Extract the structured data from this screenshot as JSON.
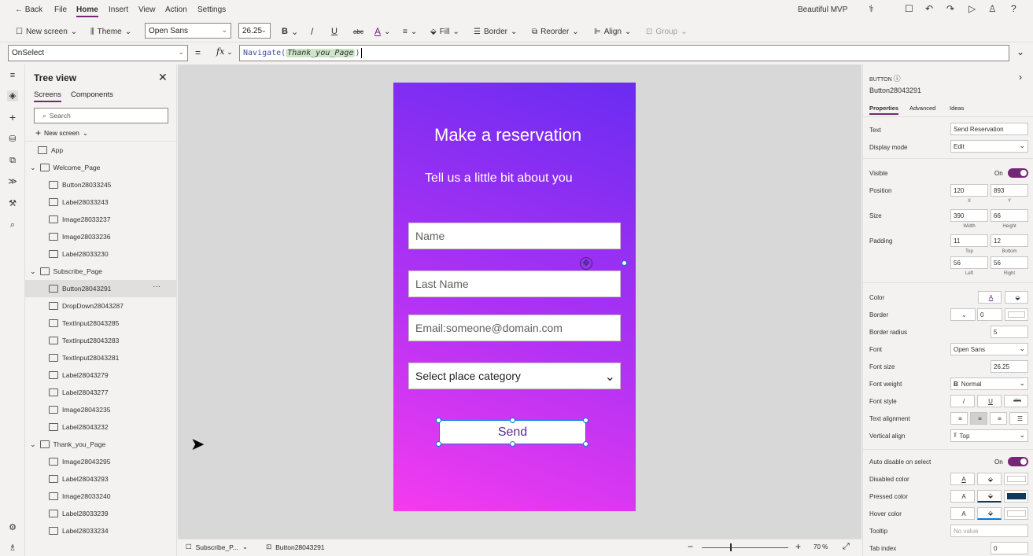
{
  "topbar": {
    "back": "Back",
    "menu": [
      "File",
      "Home",
      "Insert",
      "View",
      "Action",
      "Settings"
    ],
    "app_name": "Beautiful MVP"
  },
  "ribbon": {
    "new_screen": "New screen",
    "theme": "Theme",
    "font": "Open Sans",
    "font_size": "26.25",
    "bold": "B",
    "italic": "/",
    "underline": "U",
    "strike": "abc",
    "font_color": "A",
    "fill": "Fill",
    "border": "Border",
    "reorder": "Reorder",
    "align": "Align",
    "group": "Group"
  },
  "formula": {
    "property": "OnSelect",
    "equals": "=",
    "fx": "fx",
    "fn": "Navigate(",
    "arg": "Thank_you_Page",
    "close": ")"
  },
  "tree": {
    "title": "Tree view",
    "tabs": [
      "Screens",
      "Components"
    ],
    "search_placeholder": "Search",
    "new_screen": "New screen",
    "nodes": [
      {
        "label": "App",
        "level": 0
      },
      {
        "label": "Welcome_Page",
        "level": 1
      },
      {
        "label": "Button28033245",
        "level": 2
      },
      {
        "label": "Label28033243",
        "level": 2
      },
      {
        "label": "Image28033237",
        "level": 2
      },
      {
        "label": "Image28033236",
        "level": 2
      },
      {
        "label": "Label28033230",
        "level": 2
      },
      {
        "label": "Subscribe_Page",
        "level": 1
      },
      {
        "label": "Button28043291",
        "level": 2
      },
      {
        "label": "DropDown28043287",
        "level": 2
      },
      {
        "label": "TextInput28043285",
        "level": 2
      },
      {
        "label": "TextInput28043283",
        "level": 2
      },
      {
        "label": "TextInput28043281",
        "level": 2
      },
      {
        "label": "Label28043279",
        "level": 2
      },
      {
        "label": "Label28043277",
        "level": 2
      },
      {
        "label": "Image28043235",
        "level": 2
      },
      {
        "label": "Label28043232",
        "level": 2
      },
      {
        "label": "Thank_you_Page",
        "level": 1
      },
      {
        "label": "Image28043295",
        "level": 2
      },
      {
        "label": "Label28043293",
        "level": 2
      },
      {
        "label": "Image28033240",
        "level": 2
      },
      {
        "label": "Label28033239",
        "level": 2
      },
      {
        "label": "Label28033234",
        "level": 2
      }
    ],
    "more": "···"
  },
  "screen": {
    "title": "Make a reservation",
    "subtitle": "Tell us a little bit about you",
    "name": "Name",
    "last_name": "Last Name",
    "email": "Email:someone@domain.com",
    "category": "Select place category",
    "send": "Send"
  },
  "bottom": {
    "screen": "Subscribe_P...",
    "control": "Button28043291",
    "zoom_minus": "−",
    "zoom_plus": "+",
    "zoom": "70",
    "zoom_unit": "%",
    "zoom_level": 0.33
  },
  "props": {
    "type": "BUTTON",
    "name": "Button28043291",
    "tabs": [
      "Properties",
      "Advanced",
      "Ideas"
    ],
    "text_label": "Text",
    "text_value": "Send Reservation",
    "display_label": "Display mode",
    "display_value": "Edit",
    "visible_label": "Visible",
    "visible_value": "On",
    "position_label": "Position",
    "pos_x": "120",
    "pos_y": "893",
    "x": "X",
    "y": "Y",
    "size_label": "Size",
    "width": "390",
    "height": "66",
    "width_label": "Width",
    "height_label": "Height",
    "padding_label": "Padding",
    "pad_top": "11",
    "pad_bottom": "12",
    "pad_left": "56",
    "pad_right": "56",
    "top": "Top",
    "bottom": "Bottom",
    "left": "Left",
    "right": "Right",
    "color_label": "Color",
    "border_label": "Border",
    "border_value": "0",
    "radius_label": "Border radius",
    "radius_value": "5",
    "font_label": "Font",
    "font_value": "Open Sans",
    "fsize_label": "Font size",
    "fsize_value": "26.25",
    "fweight_label": "Font weight",
    "fweight_value": "Normal",
    "fstyle_label": "Font style",
    "talign_label": "Text alignment",
    "valign_label": "Vertical align",
    "valign_value": "Top",
    "auto_label": "Auto disable on select",
    "auto_value": "On",
    "disabled_label": "Disabled color",
    "pressed_label": "Pressed color",
    "hover_label": "Hover color",
    "tooltip_label": "Tooltip",
    "tooltip_placeholder": "No value",
    "tab_label": "Tab index",
    "tab_value": "0"
  },
  "colors": {
    "accent": "#742774",
    "pressed": "#0f3a5c",
    "send_text": "#5b2b8c"
  }
}
